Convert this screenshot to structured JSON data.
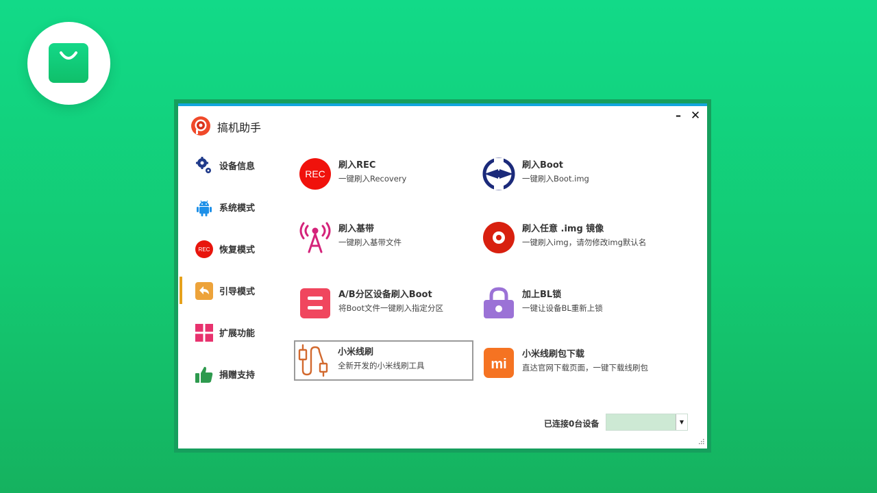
{
  "app": {
    "title": "搞机助手"
  },
  "window_controls": {
    "minimize": "–",
    "close": "✕"
  },
  "nav": [
    {
      "label": "设备信息",
      "icon": "gears-icon"
    },
    {
      "label": "系统模式",
      "icon": "android-icon"
    },
    {
      "label": "恢复模式",
      "icon": "rec-icon"
    },
    {
      "label": "引导模式",
      "icon": "reply-arrow-icon",
      "active": true
    },
    {
      "label": "扩展功能",
      "icon": "grid-icon"
    },
    {
      "label": "捐赠支持",
      "icon": "thumbs-up-icon"
    }
  ],
  "actions": [
    {
      "title": "刷入REC",
      "subtitle": "一键刷入Recovery",
      "icon_text": "REC"
    },
    {
      "title": "刷入Boot",
      "subtitle": "一键刷入Boot.img"
    },
    {
      "title": "刷入基带",
      "subtitle": "一键刷入基带文件"
    },
    {
      "title": "刷入任意 .img 镜像",
      "subtitle": "一键刷入img，请勿修改img默认名"
    },
    {
      "title": "A/B分区设备刷入Boot",
      "subtitle": "将Boot文件一键刷入指定分区"
    },
    {
      "title": "加上BL锁",
      "subtitle": "一键让设备BL重新上锁"
    },
    {
      "title": "小米线刷",
      "subtitle": "全新开发的小米线刷工具",
      "selected": true
    },
    {
      "title": "小米线刷包下载",
      "subtitle": "直达官网下载页面，一键下载线刷包",
      "icon_text": "mi"
    }
  ],
  "nav_icon_rec_text": "REC",
  "status": {
    "connected_text": "已连接0台设备",
    "device_select_value": ""
  },
  "colors": {
    "accent_bar": "#13a5dd",
    "active_indicator": "#e6a21c",
    "background": "#13c972"
  }
}
